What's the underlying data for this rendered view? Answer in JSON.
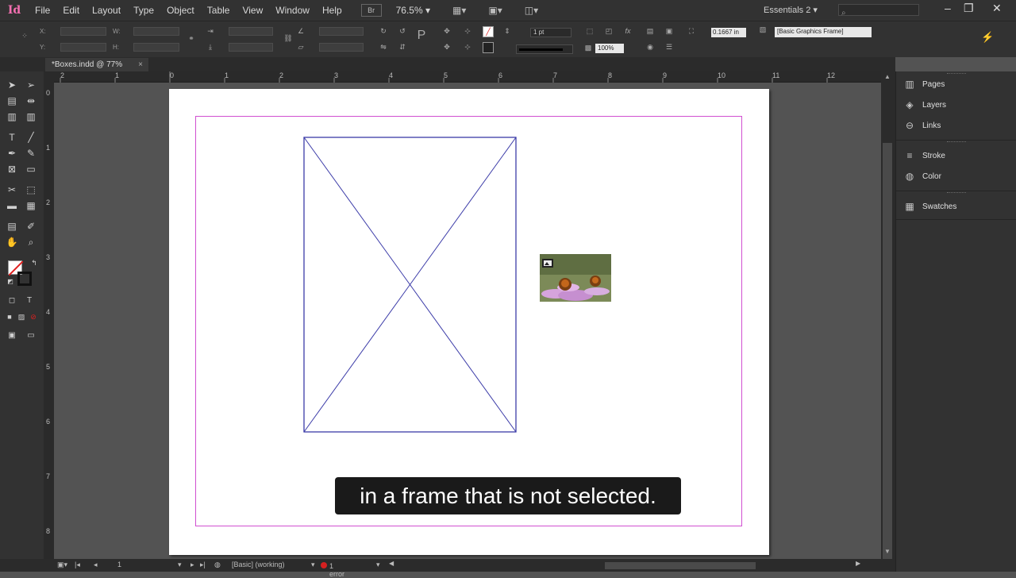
{
  "app": {
    "logo": "Id",
    "menu": [
      "File",
      "Edit",
      "Layout",
      "Type",
      "Object",
      "Table",
      "View",
      "Window",
      "Help"
    ],
    "bridge_label": "Br",
    "zoom": "76.5%",
    "workspace": "Essentials 2",
    "window_controls": [
      "–",
      "❐",
      "✕"
    ]
  },
  "control_panel": {
    "x_label": "X:",
    "y_label": "Y:",
    "w_label": "W:",
    "h_label": "H:",
    "stroke_weight": "1 pt",
    "opacity": "100%",
    "fitting_value": "0.1667 in",
    "object_style": "[Basic Graphics Frame]"
  },
  "document": {
    "tab_title": "*Boxes.indd @ 77%",
    "tab_close": "×"
  },
  "rulers": {
    "horizontal": [
      "2",
      "1",
      "0",
      "1",
      "2",
      "3",
      "4",
      "5",
      "6",
      "7",
      "8",
      "9",
      "10",
      "11",
      "12"
    ],
    "vertical": [
      "0",
      "1",
      "2",
      "3",
      "4",
      "5",
      "6",
      "7",
      "8"
    ]
  },
  "panels": [
    {
      "label": "Pages",
      "icon": "pages-icon",
      "glyph": "▥"
    },
    {
      "label": "Layers",
      "icon": "layers-icon",
      "glyph": "◈"
    },
    {
      "label": "Links",
      "icon": "links-icon",
      "glyph": "⊖"
    },
    {
      "label": "Stroke",
      "icon": "stroke-icon",
      "glyph": "≡"
    },
    {
      "label": "Color",
      "icon": "color-icon",
      "glyph": "◍"
    },
    {
      "label": "Swatches",
      "icon": "swatches-icon",
      "glyph": "▦"
    }
  ],
  "status": {
    "page": "1",
    "preflight_profile": "[Basic] (working)",
    "errors": "1 error"
  },
  "caption": "in a frame that is not selected.",
  "colors": {
    "margin_guide": "#d14fd1",
    "frame_stroke": "#3b3ba8",
    "error": "#d42020"
  }
}
